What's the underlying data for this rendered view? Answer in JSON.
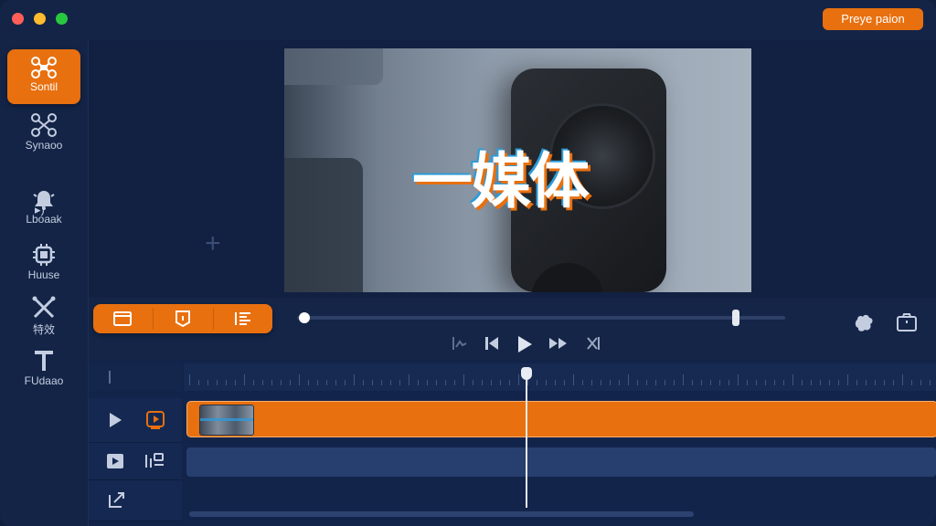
{
  "window": {
    "export_label": "Preye paion",
    "colors": {
      "accent": "#e8700f",
      "background": "#132446",
      "track_blue": "#263f6e"
    }
  },
  "sidebar": {
    "items": [
      {
        "label": "Sontil",
        "icon": "drone-icon",
        "active": true
      },
      {
        "label": "Synaoo",
        "icon": "network-icon",
        "active": false
      },
      {
        "label": "Lboaak",
        "icon": "bell-icon",
        "active": false
      },
      {
        "label": "Huuse",
        "icon": "chip-icon",
        "active": false
      },
      {
        "label": "特效",
        "icon": "effects-icon",
        "active": false
      },
      {
        "label": "FUdaao",
        "icon": "text-icon",
        "active": false
      }
    ],
    "extra_label": "▸)",
    "bottom_icon": "list-icon"
  },
  "preview": {
    "overlay_text": "一媒体",
    "add_icon": "+"
  },
  "toolbar": {
    "tools": [
      "frame-icon",
      "crop-icon",
      "list-icon"
    ],
    "playback_progress": 0.0,
    "transport": [
      "split-icon",
      "skip-back-icon",
      "play-icon",
      "fast-forward-icon",
      "marker-icon"
    ],
    "right_icons": [
      "settings-icon",
      "folder-icon"
    ]
  },
  "timeline": {
    "tracks": [
      {
        "name": "video-track",
        "icons": [
          "play-icon",
          "video-clip-icon"
        ]
      },
      {
        "name": "audio-track",
        "icons": [
          "film-icon",
          "audio-settings-icon"
        ]
      },
      {
        "name": "effects-track",
        "icons": [
          "export-icon"
        ]
      }
    ]
  }
}
